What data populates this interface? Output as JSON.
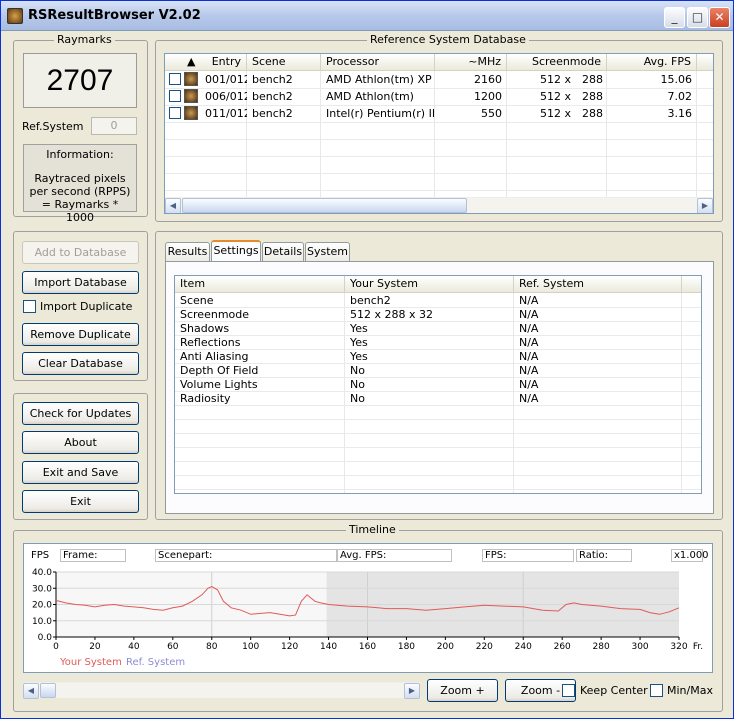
{
  "window": {
    "title": "RSResultBrowser V2.02"
  },
  "raymarks": {
    "group_label": "Raymarks",
    "score": "2707",
    "ref_system_label": "Ref.System",
    "ref_system_value": "0",
    "info_title": "Information:",
    "info_text": "Raytraced pixels per second (RPPS) = Raymarks * 1000"
  },
  "db_buttons": {
    "add": "Add to Database",
    "import": "Import Database",
    "import_duplicate": "Import Duplicate",
    "remove_duplicate": "Remove Duplicate",
    "clear": "Clear Database"
  },
  "app_buttons": {
    "check_updates": "Check for Updates",
    "about": "About",
    "exit_save": "Exit and Save",
    "exit": "Exit"
  },
  "refdb": {
    "group_label": "Reference System Database",
    "sort_indicator": "▲",
    "columns": [
      "Entry",
      "Scene",
      "Processor",
      "~MHz",
      "Screenmode",
      "Avg. FPS"
    ],
    "rows": [
      {
        "entry": "001/012",
        "scene": "bench2",
        "processor": "AMD Athlon(tm) XP",
        "mhz": "2160",
        "screen_w": "512 x",
        "screen_h": "288",
        "fps": "15.06"
      },
      {
        "entry": "006/012",
        "scene": "bench2",
        "processor": "AMD Athlon(tm)",
        "mhz": "1200",
        "screen_w": "512 x",
        "screen_h": "288",
        "fps": "7.02"
      },
      {
        "entry": "011/012",
        "scene": "bench2",
        "processor": "Intel(r) Pentium(r) III",
        "mhz": "550",
        "screen_w": "512 x",
        "screen_h": "288",
        "fps": "3.16"
      }
    ]
  },
  "tabs": [
    "Results",
    "Settings",
    "Details",
    "System"
  ],
  "active_tab": "Settings",
  "settings": {
    "columns": [
      "Item",
      "Your System",
      "Ref. System"
    ],
    "rows": [
      {
        "item": "Scene",
        "yours": "bench2",
        "ref": "N/A"
      },
      {
        "item": "Screenmode",
        "yours": "512 x 288 x 32",
        "ref": "N/A"
      },
      {
        "item": "Shadows",
        "yours": "Yes",
        "ref": "N/A"
      },
      {
        "item": "Reflections",
        "yours": "Yes",
        "ref": "N/A"
      },
      {
        "item": "Anti Aliasing",
        "yours": "Yes",
        "ref": "N/A"
      },
      {
        "item": "Depth Of Field",
        "yours": "No",
        "ref": "N/A"
      },
      {
        "item": "Volume Lights",
        "yours": "No",
        "ref": "N/A"
      },
      {
        "item": "Radiosity",
        "yours": "No",
        "ref": "N/A"
      }
    ]
  },
  "timeline": {
    "group_label": "Timeline",
    "labels": {
      "fps_axis": "FPS",
      "frame": "Frame:",
      "scenepart": "Scenepart:",
      "avg_fps": "Avg. FPS:",
      "fps": "FPS:",
      "ratio": "Ratio:",
      "zoom": "x1.000",
      "x_unit": "Fr."
    },
    "legend": {
      "your_system": "Your System",
      "ref_system": "Ref. System"
    },
    "zoom_in": "Zoom +",
    "zoom_out": "Zoom -",
    "keep_center": "Keep Center",
    "min_max": "Min/Max",
    "colors": {
      "your_line": "#e05a5a",
      "ref_text": "#8c8cd8",
      "shade": "#e4e4e4"
    }
  },
  "chart_data": {
    "type": "line",
    "xlabel": "Fr.",
    "ylabel": "FPS",
    "xlim": [
      0,
      320
    ],
    "ylim": [
      0,
      40
    ],
    "xticks": [
      0,
      20,
      40,
      60,
      80,
      100,
      120,
      140,
      160,
      180,
      200,
      220,
      240,
      260,
      280,
      300,
      320
    ],
    "yticks": [
      "0.0",
      "10.0",
      "20.0",
      "30.0",
      "40.0"
    ],
    "shaded_range": [
      139,
      320
    ],
    "series": [
      {
        "name": "Your System",
        "x": [
          0,
          5,
          10,
          15,
          20,
          25,
          30,
          35,
          40,
          45,
          50,
          55,
          60,
          65,
          70,
          75,
          78,
          80,
          83,
          86,
          90,
          95,
          100,
          105,
          110,
          115,
          120,
          123,
          126,
          129,
          131,
          133,
          136,
          140,
          150,
          160,
          170,
          180,
          190,
          200,
          210,
          220,
          230,
          240,
          250,
          258,
          262,
          266,
          270,
          280,
          290,
          300,
          305,
          310,
          315,
          320
        ],
        "y": [
          22.5,
          21,
          20,
          19.5,
          18.5,
          19.5,
          20,
          19,
          18.5,
          18,
          17,
          16.5,
          18,
          19,
          22,
          26,
          30,
          31,
          29,
          22,
          18,
          16.5,
          14,
          14.5,
          15,
          14,
          13,
          13.5,
          22,
          26,
          24,
          22,
          21,
          20,
          19,
          18.5,
          17.5,
          17.5,
          16.5,
          17.5,
          18.5,
          19.5,
          19,
          18.5,
          16.5,
          16,
          20,
          21,
          20,
          19,
          17.5,
          17,
          15,
          14,
          15.5,
          18
        ]
      }
    ],
    "legend": [
      "Your System",
      "Ref. System"
    ]
  }
}
